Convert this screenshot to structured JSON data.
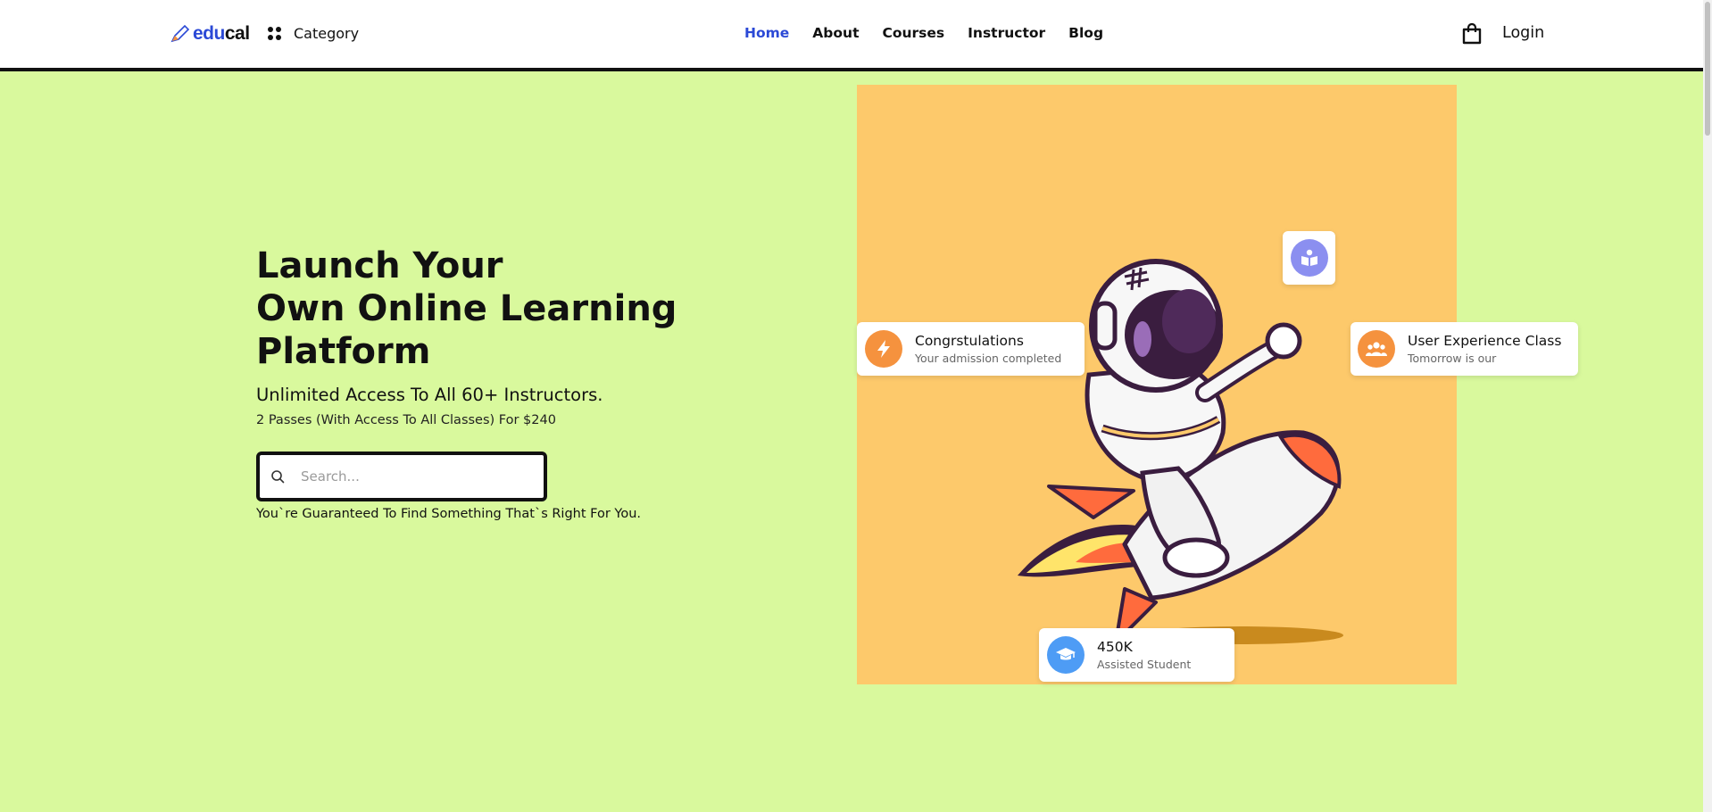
{
  "header": {
    "logo_part1": "edu",
    "logo_part2": "cal",
    "category_label": "Category",
    "nav": [
      {
        "label": "Home",
        "active": true
      },
      {
        "label": "About",
        "active": false
      },
      {
        "label": "Courses",
        "active": false
      },
      {
        "label": "Instructor",
        "active": false
      },
      {
        "label": "Blog",
        "active": false
      }
    ],
    "login_label": "Login",
    "icons": {
      "category": "grid-dots-icon",
      "cart": "shopping-bag-icon",
      "logo": "pencil-icon"
    }
  },
  "hero": {
    "title_lines": [
      "Launch Your",
      "Own Online Learning",
      "Platform"
    ],
    "subtitle": "Unlimited Access To All 60+ Instructors.",
    "passes": "2 Passes (With Access To All Classes) For $240",
    "search": {
      "placeholder": "Search...",
      "value": ""
    },
    "guarantee": "You`re Guaranteed To Find Something That`s Right For You."
  },
  "cards": {
    "congrats": {
      "title": "Congrstulations",
      "subtitle": "Your admission completed",
      "icon": "lightning-icon"
    },
    "ux_class": {
      "title": "User Experience Class",
      "subtitle": "Tomorrow is our",
      "icon": "users-icon"
    },
    "book": {
      "icon": "book-reader-icon"
    },
    "students": {
      "title": "450K",
      "subtitle": "Assisted Student",
      "icon": "graduation-cap-icon"
    }
  },
  "colors": {
    "hero_bg": "#d9f99d",
    "panel_bg": "#fdc96b",
    "accent_blue": "#2b49d6",
    "orange": "#f5923e",
    "purple": "#8b8ff0",
    "sky": "#4e9cf5"
  }
}
